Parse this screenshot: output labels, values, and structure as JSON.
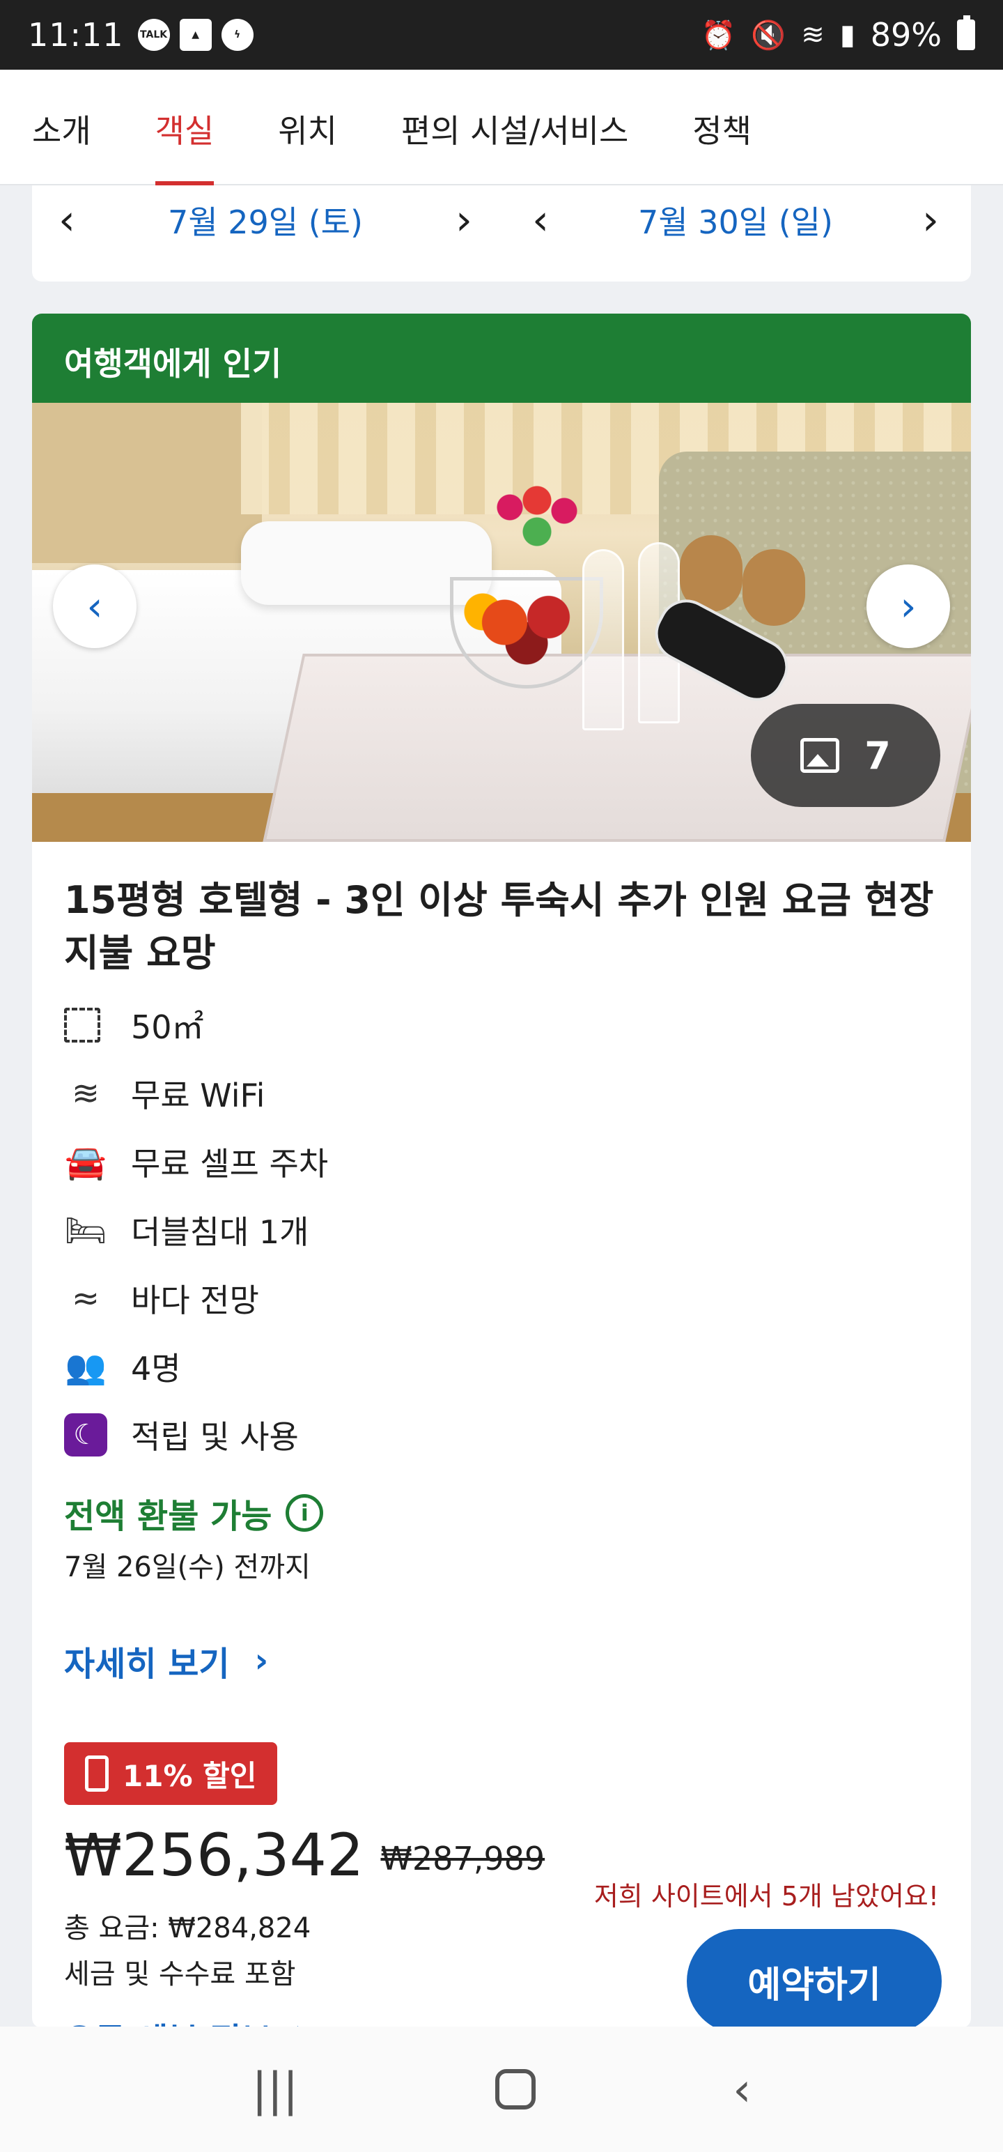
{
  "status_bar": {
    "time": "11:11",
    "battery": "89%",
    "left_icons": [
      "talk-icon",
      "gallery-icon",
      "bolt-icon"
    ],
    "right_icons": [
      "alarm-icon",
      "mute-icon",
      "wifi-icon",
      "signal-icon",
      "battery-icon"
    ]
  },
  "tabs": [
    {
      "label": "소개",
      "active": false
    },
    {
      "label": "객실",
      "active": true
    },
    {
      "label": "위치",
      "active": false
    },
    {
      "label": "편의 시설/서비스",
      "active": false
    },
    {
      "label": "정책",
      "active": false
    }
  ],
  "dates": {
    "check_in": "7월 29일 (토)",
    "check_out": "7월 30일 (일)"
  },
  "room": {
    "banner": "여행객에게 인기",
    "photo_count": "7",
    "title": "15평형 호텔형 - 3인 이상 투숙시 추가 인원 요금 현장 지불 요망",
    "features": [
      {
        "icon": "area-icon",
        "text": "50㎡"
      },
      {
        "icon": "wifi-icon",
        "text": "무료 WiFi"
      },
      {
        "icon": "car-icon",
        "text": "무료 셀프 주차"
      },
      {
        "icon": "bed-icon",
        "text": "더블침대 1개"
      },
      {
        "icon": "waves-icon",
        "text": "바다 전망"
      },
      {
        "icon": "people-icon",
        "text": "4명"
      },
      {
        "icon": "rewards-moon-icon",
        "text": "적립 및 사용"
      }
    ],
    "refund": "전액 환불 가능",
    "refund_date": "7월 26일(수) 전까지",
    "details_link": "자세히 보기",
    "discount": "11% 할인",
    "price_current": "₩256,342",
    "price_old": "₩287,989",
    "total": "총 요금: ₩284,824",
    "tax_note": "세금 및 수수료 포함",
    "price_details": "요금 세부 정보",
    "remaining": "저희 사이트에서 5개 남았어요!",
    "book": "예약하기"
  },
  "colors": {
    "accent_red": "#d32f2f",
    "link_blue": "#1565c0",
    "green": "#1e7e34",
    "rewards_purple": "#6a1b9a"
  }
}
